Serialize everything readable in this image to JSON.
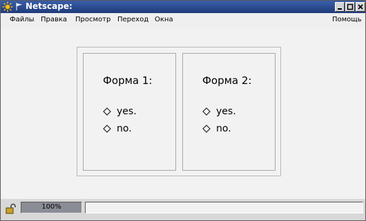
{
  "window": {
    "title": "Netscape:"
  },
  "menu": {
    "items": [
      {
        "label": "Файлы"
      },
      {
        "label": "Правка"
      },
      {
        "label": "Просмотр"
      },
      {
        "label": "Переход"
      },
      {
        "label": "Окна"
      }
    ],
    "help": "Помощь"
  },
  "frames": [
    {
      "title": "Форма 1:",
      "options": [
        "yes.",
        "no."
      ]
    },
    {
      "title": "Форма 2:",
      "options": [
        "yes.",
        "no."
      ]
    }
  ],
  "status": {
    "progress_text": "100%",
    "progress_fraction": 1.0,
    "message": ""
  },
  "colors": {
    "titlebar": "#1f3a7a",
    "progress": "#8a8d95"
  }
}
